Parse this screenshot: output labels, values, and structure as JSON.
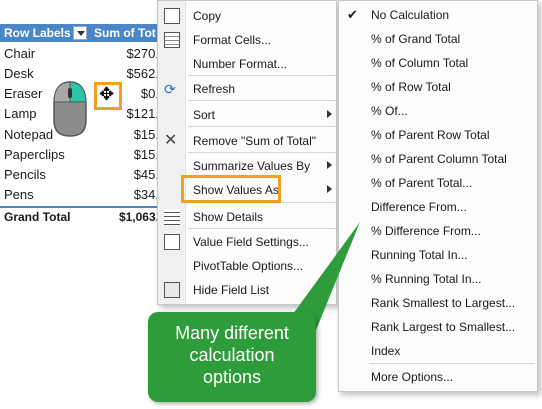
{
  "pivot": {
    "header_labels": "Row Labels",
    "header_values": "Sum of Tot",
    "rows": [
      {
        "label": "Chair",
        "value": "$270."
      },
      {
        "label": "Desk",
        "value": "$562."
      },
      {
        "label": "Eraser",
        "value": "$0."
      },
      {
        "label": "Lamp",
        "value": "$121."
      },
      {
        "label": "Notepad",
        "value": "$15."
      },
      {
        "label": "Paperclips",
        "value": "$15."
      },
      {
        "label": "Pencils",
        "value": "$45."
      },
      {
        "label": "Pens",
        "value": "$34."
      }
    ],
    "grand_label": "Grand Total",
    "grand_value": "$1,063."
  },
  "context_menu": {
    "items": [
      {
        "label": "Copy",
        "icon": "copy-icon"
      },
      {
        "label": "Format Cells...",
        "icon": "format-cells-icon"
      },
      {
        "label": "Number Format...",
        "icon": ""
      },
      {
        "label": "Refresh",
        "icon": "refresh-icon"
      },
      {
        "label": "Sort",
        "icon": ""
      },
      {
        "label": "Remove \"Sum of Total\"",
        "icon": "remove-x-icon"
      },
      {
        "label": "Summarize Values By",
        "icon": ""
      },
      {
        "label": "Show Values As",
        "icon": ""
      },
      {
        "label": "Show Details",
        "icon": "show-details-icon"
      },
      {
        "label": "Value Field Settings...",
        "icon": "field-settings-icon"
      },
      {
        "label": "PivotTable Options...",
        "icon": ""
      },
      {
        "label": "Hide Field List",
        "icon": "field-list-icon"
      }
    ]
  },
  "show_values_submenu": {
    "items": [
      {
        "label": "No Calculation",
        "checked": "✔"
      },
      {
        "label": "% of Grand Total"
      },
      {
        "label": "% of Column Total"
      },
      {
        "label": "% of Row Total"
      },
      {
        "label": "% Of..."
      },
      {
        "label": "% of Parent Row Total"
      },
      {
        "label": "% of Parent Column Total"
      },
      {
        "label": "% of Parent Total..."
      },
      {
        "label": "Difference From..."
      },
      {
        "label": "% Difference From..."
      },
      {
        "label": "Running Total In..."
      },
      {
        "label": "% Running Total In..."
      },
      {
        "label": "Rank Smallest to Largest..."
      },
      {
        "label": "Rank Largest to Smallest..."
      },
      {
        "label": "Index"
      },
      {
        "label": "More Options..."
      }
    ]
  },
  "callout": {
    "line1": "Many different",
    "line2": "calculation",
    "line3": "options"
  },
  "colors": {
    "pivot_header": "#4a86c5",
    "highlight": "#f0a020",
    "callout": "#2e9c3a"
  }
}
